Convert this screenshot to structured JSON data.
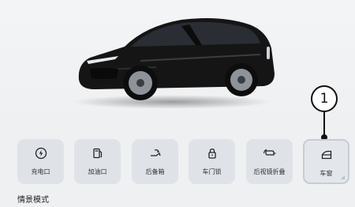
{
  "controls": [
    {
      "label": "充电口",
      "icon": "power-icon"
    },
    {
      "label": "加油口",
      "icon": "fuel-pump-icon"
    },
    {
      "label": "后备箱",
      "icon": "trunk-icon"
    },
    {
      "label": "车门锁",
      "icon": "lock-icon"
    },
    {
      "label": "后视镜折叠",
      "icon": "mirror-fold-icon"
    },
    {
      "label": "车窗",
      "icon": "window-icon"
    }
  ],
  "callout": {
    "number": "1"
  },
  "section": {
    "title": "情景模式"
  },
  "colors": {
    "background": "#eef0f2",
    "tile": "#dfe3e8",
    "car": "#141414"
  }
}
